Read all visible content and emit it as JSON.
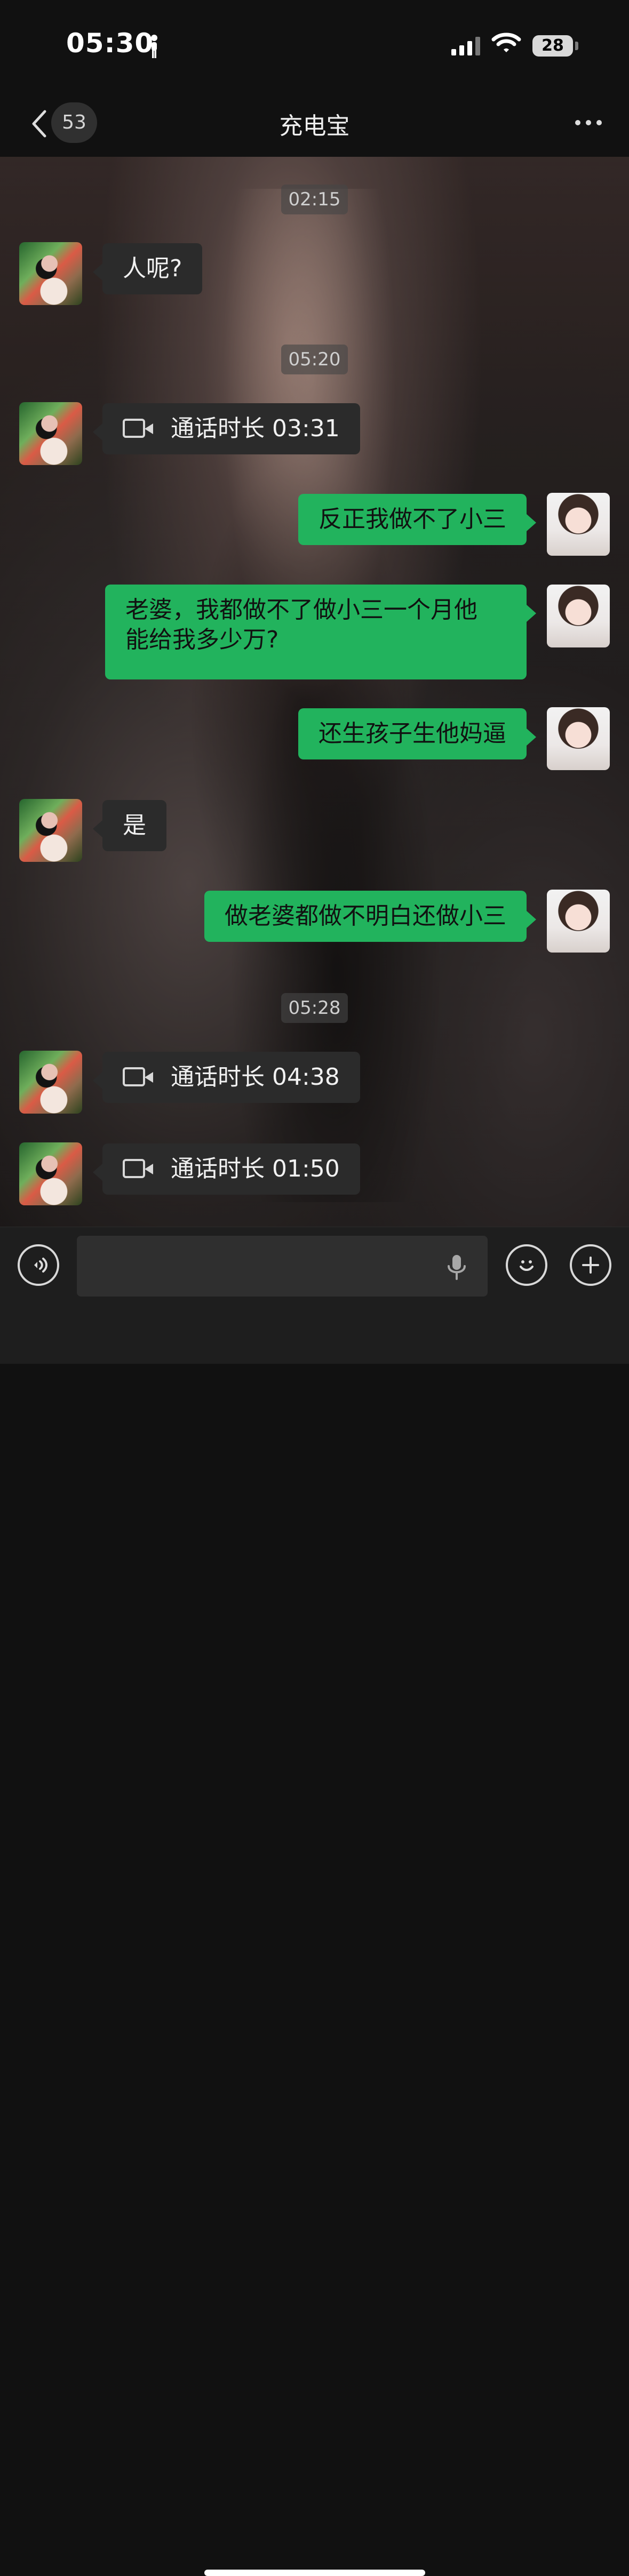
{
  "status_bar": {
    "time": "05:30",
    "battery": "28"
  },
  "navigation": {
    "unread_count": "53",
    "title": "充电宝"
  },
  "messages": {
    "timestamp_1": "02:15",
    "msg_1": "人呢?",
    "timestamp_2": "05:20",
    "call_1": "通话时长 03:31",
    "msg_2": "反正我做不了小三",
    "msg_3_line_1": "老婆，我都做不了做小三一个月他",
    "msg_3_line_2": "能给我多少万?",
    "msg_4": "还生孩子生他妈逼",
    "msg_5": "是",
    "msg_6": "做老婆都做不明白还做小三",
    "timestamp_3": "05:28",
    "call_2": "通话时长 04:38",
    "call_3": "通话时长 01:50"
  }
}
